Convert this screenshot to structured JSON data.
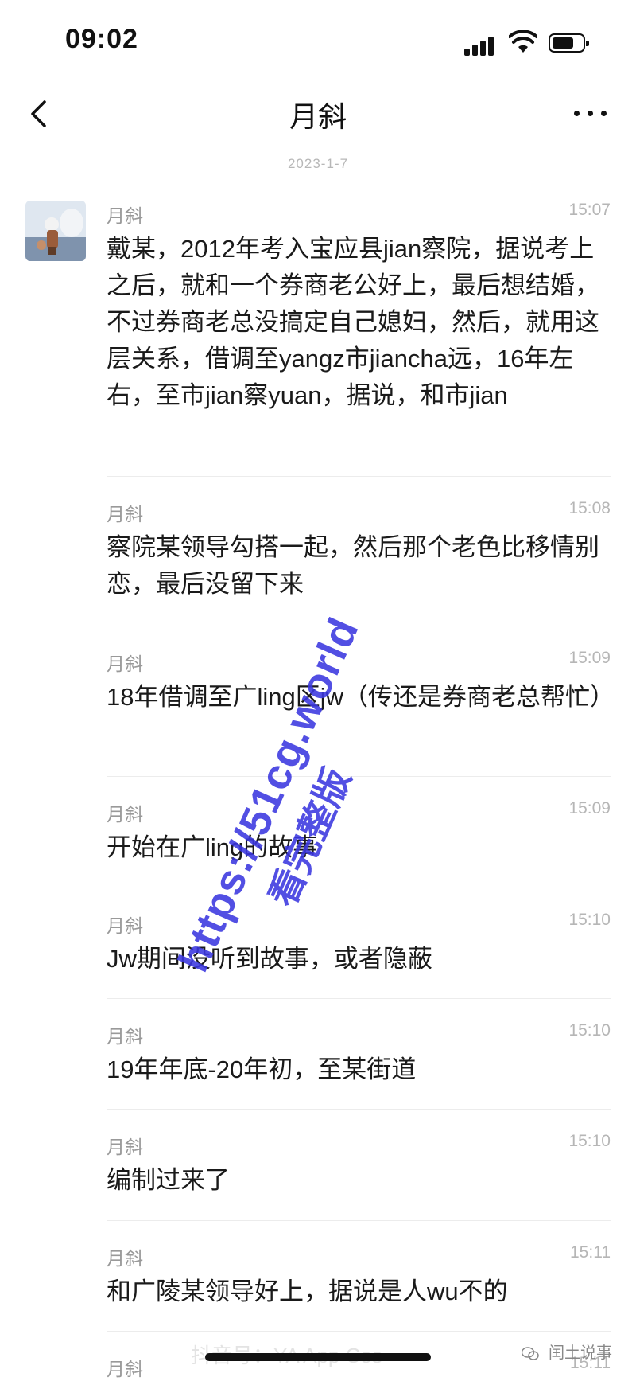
{
  "status_bar": {
    "time": "09:02"
  },
  "header": {
    "title": "月斜"
  },
  "chat": {
    "date": "2023-1-7",
    "messages": [
      {
        "sender": "月斜",
        "time": "15:07",
        "text": "戴某，2012年考入宝应县jian察院，据说考上之后，就和一个券商老公好上，最后想结婚，不过券商老总没搞定自己媳妇，然后，就用这层关系，借调至yangz市jiancha远，16年左右，至市jian察yuan，据说，和市jian"
      },
      {
        "sender": "月斜",
        "time": "15:08",
        "text": "察院某领导勾搭一起，然后那个老色比移情别恋，最后没留下来"
      },
      {
        "sender": "月斜",
        "time": "15:09",
        "text": "18年借调至广ling区jw（传还是券商老总帮忙）"
      },
      {
        "sender": "月斜",
        "time": "15:09",
        "text": "开始在广ling的故事"
      },
      {
        "sender": "月斜",
        "time": "15:10",
        "text": "Jw期间没听到故事，或者隐蔽"
      },
      {
        "sender": "月斜",
        "time": "15:10",
        "text": "19年年底-20年初，至某街道"
      },
      {
        "sender": "月斜",
        "time": "15:10",
        "text": "编制过来了"
      },
      {
        "sender": "月斜",
        "time": "15:11",
        "text": "和广陵某领导好上，据说是人wu不的"
      },
      {
        "sender": "月斜",
        "time": "15:11",
        "text": ""
      }
    ]
  },
  "watermark": {
    "url": "https://51cg.world",
    "subtitle": "看完整版",
    "colors": {
      "accent": "#3b37e0"
    }
  },
  "bottom_watermarks": {
    "left": "抖音号：YA App Cos",
    "right": "闰土说事"
  },
  "colors": {
    "background": "#ffffff",
    "meta_text": "#999999",
    "divider": "#ececec"
  }
}
